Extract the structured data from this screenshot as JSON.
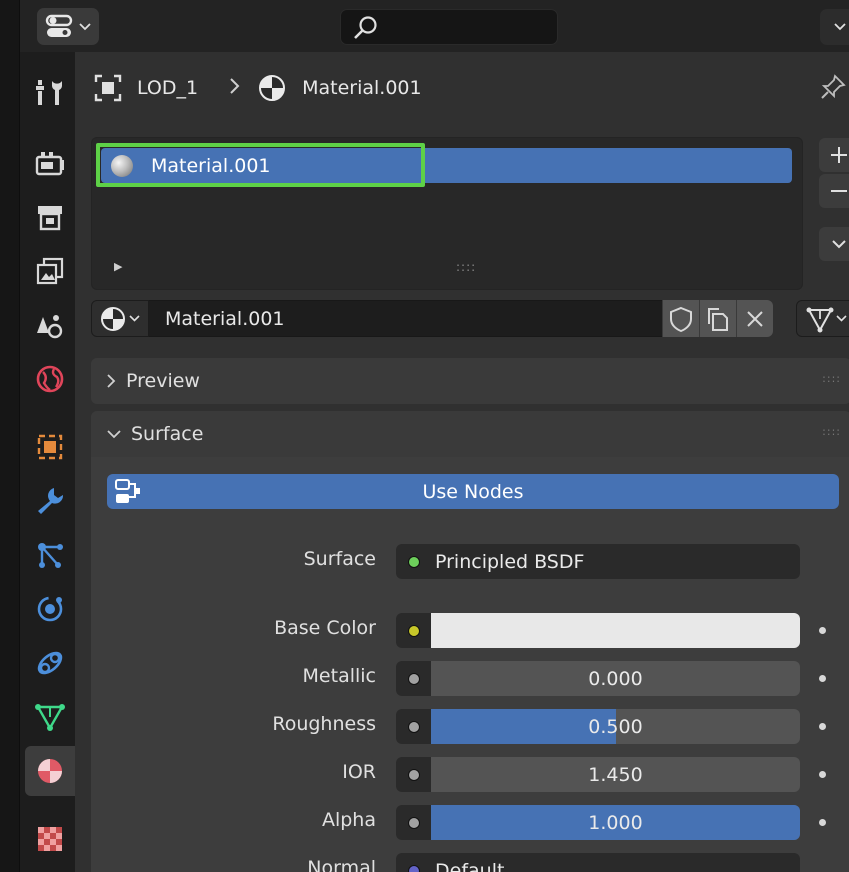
{
  "breadcrumb": {
    "object": "LOD_1",
    "material": "Material.001"
  },
  "material_slots": [
    {
      "name": "Material.001",
      "selected": true
    }
  ],
  "material_selector": {
    "name": "Material.001"
  },
  "panels": {
    "preview": "Preview",
    "surface": "Surface"
  },
  "surface": {
    "use_nodes_label": "Use Nodes",
    "shader_label": "Surface",
    "shader_value": "Principled BSDF",
    "shader_socket_color": "#6dcf5b",
    "properties": [
      {
        "label": "Base Color",
        "value": "",
        "fraction": 0,
        "socket_color": "#c7c729",
        "swatch": "#e8e8e8"
      },
      {
        "label": "Metallic",
        "value": "0.000",
        "fraction": 0.0,
        "socket_color": "#a1a1a1"
      },
      {
        "label": "Roughness",
        "value": "0.500",
        "fraction": 0.5,
        "socket_color": "#a1a1a1"
      },
      {
        "label": "IOR",
        "value": "1.450",
        "fraction": 0.0,
        "socket_color": "#a1a1a1"
      },
      {
        "label": "Alpha",
        "value": "1.000",
        "fraction": 1.0,
        "socket_color": "#a1a1a1"
      },
      {
        "label": "Normal",
        "value": "Default",
        "fraction": 0,
        "socket_color": "#6363c7"
      }
    ]
  },
  "colors": {
    "accent": "#4672b4",
    "highlight": "#5ed147",
    "panel": "#303030"
  },
  "icons": [
    "editor-type-icon",
    "search-icon",
    "tool-icon",
    "render-icon",
    "output-icon",
    "view-layer-icon",
    "scene-icon",
    "world-icon",
    "object-icon",
    "modifier-icon",
    "particles-icon",
    "physics-icon",
    "constraints-icon",
    "data-icon",
    "material-icon",
    "texture-icon",
    "pin-icon"
  ]
}
